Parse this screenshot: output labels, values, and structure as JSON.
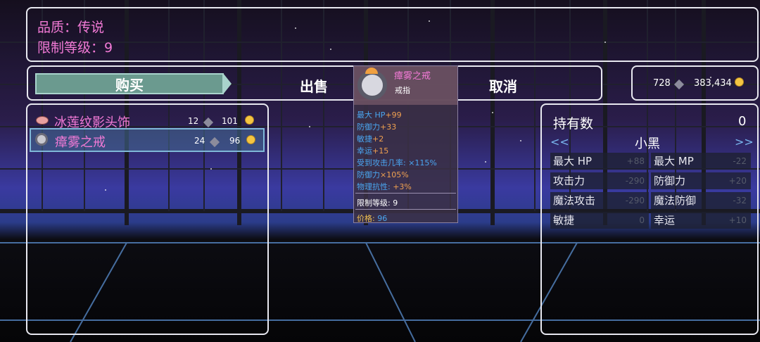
{
  "header": {
    "quality_label": "品质：传说",
    "level_limit_label": "限制等级：9"
  },
  "actions": {
    "buy": "购买",
    "sell": "出售",
    "cancel": "取消"
  },
  "currency": {
    "gems": "728",
    "gold": "383,434"
  },
  "item_list": [
    {
      "name": "冰莲纹影头饰",
      "gems": "12",
      "gold": "101",
      "selected": false
    },
    {
      "name": "瘴雾之戒",
      "gems": "24",
      "gold": "96",
      "selected": true
    }
  ],
  "tooltip": {
    "name": "瘴雾之戒",
    "type": "戒指",
    "stats": [
      {
        "label": "最大 HP",
        "bonus": "+99"
      },
      {
        "label": "防御力",
        "bonus": "+33"
      },
      {
        "label": "敏捷",
        "bonus": "+2"
      },
      {
        "label": "幸运",
        "bonus": "+15"
      },
      {
        "label": "受到攻击几率:",
        "bonus": "×115%"
      },
      {
        "label": "防御力",
        "bonus": "×105%"
      },
      {
        "label": "物理抗性:",
        "bonus": "+3%"
      }
    ],
    "level_limit": "限制等级: 9",
    "price_label": "价格:",
    "price_value": "96"
  },
  "stats_panel": {
    "owned_label": "持有数",
    "owned_value": "0",
    "prev": "<<",
    "next": ">>",
    "character": "小黑",
    "rows": [
      {
        "left": "最大 HP",
        "left_val": "+88",
        "right": "最大 MP",
        "right_val": "-22"
      },
      {
        "left": "攻击力",
        "left_val": "-290",
        "right": "防御力",
        "right_val": "+20"
      },
      {
        "left": "魔法攻击",
        "left_val": "-290",
        "right": "魔法防御",
        "right_val": "-32"
      },
      {
        "left": "敏捷",
        "left_val": "0",
        "right": "幸运",
        "right_val": "+10"
      }
    ]
  },
  "colors": {
    "accent_pink": "#f27ad6",
    "stat_blue": "#4aa6f0",
    "bonus_orange": "#f0a050",
    "gold": "#f4c542"
  }
}
